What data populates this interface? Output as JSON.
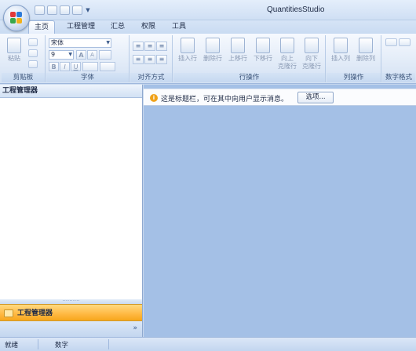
{
  "app": {
    "title": "QuantitiesStudio"
  },
  "quick_access": [
    {
      "icon": "new-file-icon"
    },
    {
      "icon": "open-folder-icon"
    },
    {
      "icon": "save-icon"
    },
    {
      "icon": "print-icon"
    }
  ],
  "tabs": [
    {
      "label": "主页",
      "active": true
    },
    {
      "label": "工程管理",
      "active": false
    },
    {
      "label": "汇总",
      "active": false
    },
    {
      "label": "权限",
      "active": false
    },
    {
      "label": "工具",
      "active": false
    }
  ],
  "ribbon": {
    "clipboard": {
      "label": "剪贴板",
      "paste_label": "粘贴"
    },
    "font": {
      "label": "字体",
      "font_name": "宋体",
      "font_size": "9",
      "bold": "B",
      "italic": "I",
      "underline": "U",
      "grow": "A",
      "shrink": "A"
    },
    "alignment": {
      "label": "对齐方式"
    },
    "row_ops": {
      "label": "行操作",
      "buttons": [
        {
          "label": "插入行",
          "icon": "insert-row-icon"
        },
        {
          "label": "删除行",
          "icon": "delete-row-icon"
        },
        {
          "label": "上移行",
          "icon": "move-row-up-icon"
        },
        {
          "label": "下移行",
          "icon": "move-row-down-icon"
        },
        {
          "label": "向上",
          "label2": "克隆行",
          "icon": "clone-row-up-icon"
        },
        {
          "label": "向下",
          "label2": "克隆行",
          "icon": "clone-row-down-icon"
        }
      ]
    },
    "col_ops": {
      "label": "列操作",
      "buttons": [
        {
          "label": "插入列",
          "icon": "insert-column-icon"
        },
        {
          "label": "删除列",
          "icon": "delete-column-icon"
        }
      ]
    },
    "number_format": {
      "label": "数字格式"
    }
  },
  "left_panel": {
    "header": "工程管理器",
    "nav_item": "工程管理器",
    "grip": "··········",
    "expand": "»"
  },
  "message_bar": {
    "text": "这是标题栏，可在其中向用户显示消息。",
    "button": "选项..."
  },
  "status_bar": {
    "ready": "就绪",
    "mode": "数字"
  },
  "colors": {
    "accent": "#ffb842",
    "main_bg": "#a4c0e6",
    "ribbon_bg": "#e3ecf8"
  }
}
